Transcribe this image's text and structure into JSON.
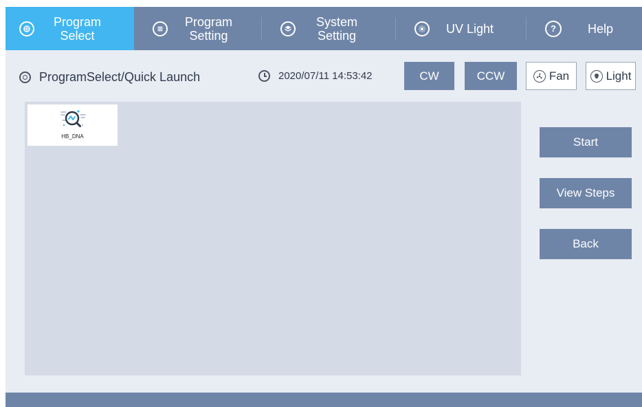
{
  "nav": {
    "items": [
      {
        "line1": "Program",
        "line2": "Select",
        "icon": "program-select-icon"
      },
      {
        "line1": "Program",
        "line2": "Setting",
        "icon": "program-setting-icon"
      },
      {
        "line1": "System",
        "line2": "Setting",
        "icon": "system-setting-icon"
      },
      {
        "line1": "UV Light",
        "line2": "",
        "icon": "uv-light-icon"
      },
      {
        "line1": "Help",
        "line2": "",
        "icon": "help-icon"
      }
    ]
  },
  "toolbar": {
    "breadcrumb": "ProgramSelect/Quick Launch",
    "datetime": "2020/07/11 14:53:42",
    "cw_label": "CW",
    "ccw_label": "CCW",
    "fan_label": "Fan",
    "light_label": "Light"
  },
  "programs": [
    {
      "name": "HB_DNA"
    }
  ],
  "actions": {
    "start_label": "Start",
    "view_steps_label": "View Steps",
    "back_label": "Back"
  },
  "colors": {
    "nav_bg": "#6f85a8",
    "nav_active": "#41b6f0",
    "page_bg": "#e8ecf3",
    "panel_bg": "#d5dbe6"
  }
}
